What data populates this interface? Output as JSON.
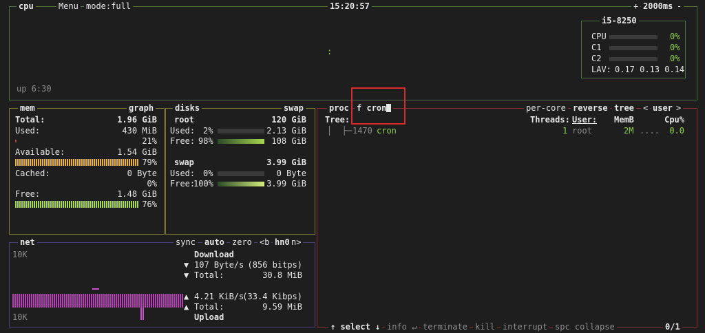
{
  "cpu_box": {
    "title": "cpu",
    "menu": "Menu",
    "mode": "mode:full",
    "clock": "15:20:57",
    "interval_minus": "-",
    "interval": "2000ms",
    "interval_plus": "+",
    "uptime": "up 6:30",
    "graph_dot": ":",
    "info": {
      "model": "i5-8250",
      "rows": [
        {
          "label": "CPU",
          "value": "0%"
        },
        {
          "label": "C1",
          "value": "0%"
        },
        {
          "label": "C2",
          "value": "0%"
        }
      ],
      "lav_label": "LAV:",
      "lav": "0.17 0.13 0.14"
    }
  },
  "mem_box": {
    "title": "mem",
    "graph_btn": "graph",
    "total_label": "Total:",
    "total_value": "1.96 GiB",
    "used_label": "Used:",
    "used_value": "430 MiB",
    "used_pct": "21%",
    "available_label": "Available:",
    "available_value": "1.54 GiB",
    "available_pct": "79%",
    "cached_label": "Cached:",
    "cached_value": "0 Byte",
    "cached_pct": "0%",
    "free_label": "Free:",
    "free_value": "1.48 GiB",
    "free_pct": "76%"
  },
  "disk_box": {
    "title": "disks",
    "swap_btn": "swap",
    "root": {
      "name": "root",
      "size": "120 GiB",
      "used_label": "Used:",
      "used_pct": "2%",
      "used_value": "2.13 GiB",
      "free_label": "Free:",
      "free_pct": "98%",
      "free_value": "108 GiB"
    },
    "swap": {
      "name": "swap",
      "size": "3.99 GiB",
      "used_label": "Used:",
      "used_pct": "0%",
      "used_value": "0 Byte",
      "free_label": "Free:",
      "free_pct": "100%",
      "free_value": "3.99 GiB"
    }
  },
  "net_box": {
    "title": "net",
    "sync": "sync",
    "auto": "auto",
    "zero": "zero",
    "iface_prev": "<b",
    "iface": "hn0",
    "iface_next": "n>",
    "scale_top": "10K",
    "scale_bottom": "10K",
    "download_label": "Download",
    "dl_rate": "107 Byte/s",
    "dl_bits": "(856 bitps)",
    "dl_total_label": "Total:",
    "dl_total": "30.8 MiB",
    "ul_rate": "4.21 KiB/s",
    "ul_bits": "(33.4 Kibps)",
    "ul_total_label": "Total:",
    "ul_total": "9.59 MiB",
    "upload_label": "Upload",
    "arrow_down": "▼",
    "arrow_up": "▲"
  },
  "proc_box": {
    "title": "proc",
    "filter_key": "f",
    "filter_value": "cron",
    "per_core": "per-core",
    "reverse": "reverse",
    "tree": "tree",
    "sort_prev": "<",
    "sort_field": "user",
    "sort_next": ">",
    "headers": {
      "tree": "Tree:",
      "threads": "Threads:",
      "user": "User:",
      "memb": "MemB",
      "cpu": "Cpu%"
    },
    "rows": [
      {
        "tree": "│  ├─",
        "pid": "1470",
        "name": "cron",
        "threads": "1",
        "user": "root",
        "mem": "2M",
        "cpu": "0.0"
      }
    ],
    "footer": {
      "select": "↑ select ↓",
      "info": "info ↵",
      "terminate": "terminate",
      "kill": "kill",
      "interrupt": "interrupt",
      "collapse": "spc collapse",
      "count": "0/1"
    }
  },
  "colors": {
    "accent_green": "#8fd14f",
    "cpu_border": "#4b6e3a",
    "mem_border": "#7f7b34",
    "net_border": "#4a3f7a",
    "proc_border": "#8c2e34",
    "highlight": "#d82a2a"
  }
}
